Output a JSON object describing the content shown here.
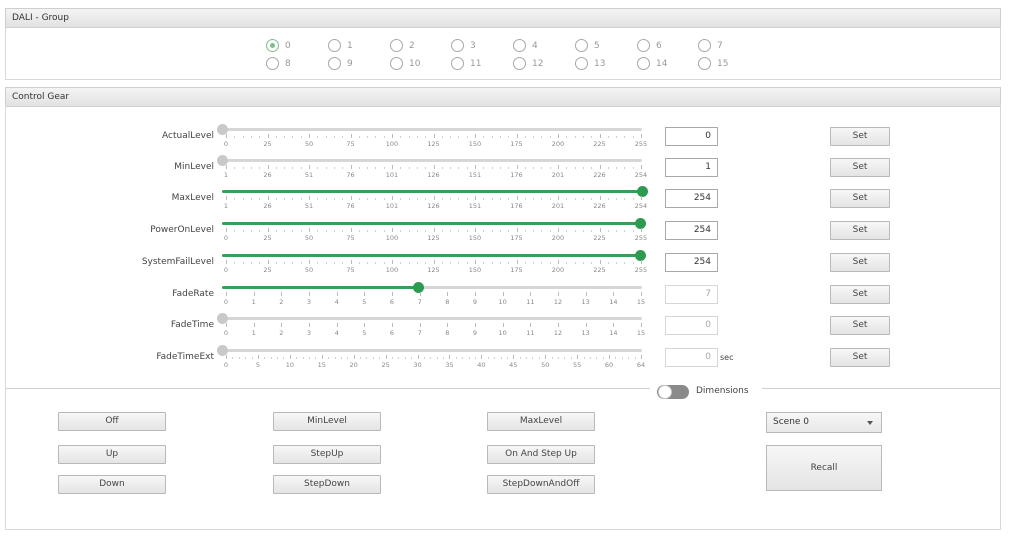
{
  "group_section": {
    "title": "DALI - Group",
    "selected": "0",
    "radios": [
      "0",
      "1",
      "2",
      "3",
      "4",
      "5",
      "6",
      "7",
      "8",
      "9",
      "10",
      "11",
      "12",
      "13",
      "14",
      "15"
    ]
  },
  "gear_section": {
    "title": "Control Gear"
  },
  "sliders": [
    {
      "label": "ActualLevel",
      "min": 0,
      "max": 255,
      "value": 0,
      "ticks": [
        "0",
        "25",
        "50",
        "75",
        "100",
        "125",
        "150",
        "175",
        "200",
        "225",
        "255"
      ],
      "field": "0",
      "enabled": true,
      "set": "Set"
    },
    {
      "label": "MinLevel",
      "min": 1,
      "max": 254,
      "value": 1,
      "ticks": [
        "1",
        "26",
        "51",
        "76",
        "101",
        "126",
        "151",
        "176",
        "201",
        "226",
        "254"
      ],
      "field": "1",
      "enabled": true,
      "set": "Set"
    },
    {
      "label": "MaxLevel",
      "min": 1,
      "max": 254,
      "value": 254,
      "ticks": [
        "1",
        "26",
        "51",
        "76",
        "101",
        "126",
        "151",
        "176",
        "201",
        "226",
        "254"
      ],
      "field": "254",
      "enabled": true,
      "set": "Set"
    },
    {
      "label": "PowerOnLevel",
      "min": 0,
      "max": 255,
      "value": 254,
      "ticks": [
        "0",
        "25",
        "50",
        "75",
        "100",
        "125",
        "150",
        "175",
        "200",
        "225",
        "255"
      ],
      "field": "254",
      "enabled": true,
      "set": "Set"
    },
    {
      "label": "SystemFailLevel",
      "min": 0,
      "max": 255,
      "value": 254,
      "ticks": [
        "0",
        "25",
        "50",
        "75",
        "100",
        "125",
        "150",
        "175",
        "200",
        "225",
        "255"
      ],
      "field": "254",
      "enabled": true,
      "set": "Set"
    },
    {
      "label": "FadeRate",
      "min": 0,
      "max": 15,
      "value": 7,
      "ticks": [
        "0",
        "1",
        "2",
        "3",
        "4",
        "5",
        "6",
        "7",
        "8",
        "9",
        "10",
        "11",
        "12",
        "13",
        "14",
        "15"
      ],
      "field": "7",
      "enabled": false,
      "set": "Set"
    },
    {
      "label": "FadeTime",
      "min": 0,
      "max": 15,
      "value": 0,
      "ticks": [
        "0",
        "1",
        "2",
        "3",
        "4",
        "5",
        "6",
        "7",
        "8",
        "9",
        "10",
        "11",
        "12",
        "13",
        "14",
        "15"
      ],
      "field": "0",
      "enabled": false,
      "set": "Set"
    },
    {
      "label": "FadeTimeExt",
      "min": 0,
      "max": 64,
      "value": 0,
      "ticks": [
        "0",
        "5",
        "10",
        "15",
        "20",
        "25",
        "30",
        "35",
        "40",
        "45",
        "50",
        "55",
        "60",
        "64"
      ],
      "field": "0",
      "unit": "sec",
      "enabled": false,
      "set": "Set"
    }
  ],
  "dimensions": {
    "label": "Dimensions",
    "on": false
  },
  "buttons": {
    "off": "Off",
    "up": "Up",
    "down": "Down",
    "min_level": "MinLevel",
    "step_up": "StepUp",
    "step_down": "StepDown",
    "max_level": "MaxLevel",
    "on_and_step_up": "On And Step Up",
    "step_down_and_off": "StepDownAndOff",
    "recall": "Recall"
  },
  "scene_select": {
    "value": "Scene 0"
  },
  "colors": {
    "accent": "#2e9a50",
    "radio_checked": "#7cbf8b"
  }
}
